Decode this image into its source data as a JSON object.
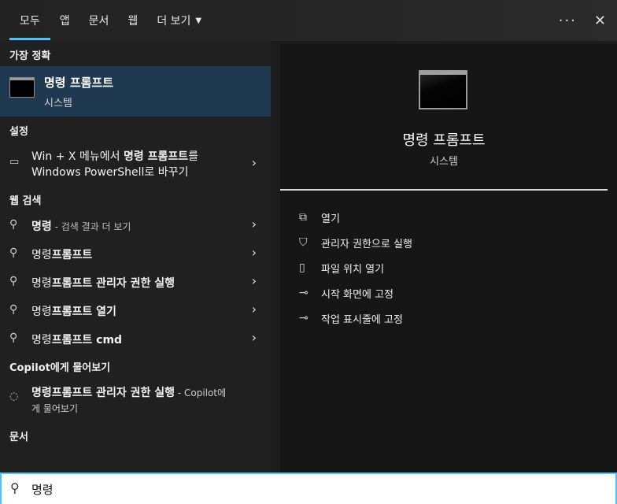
{
  "tabs": [
    {
      "label": "모두",
      "active": true
    },
    {
      "label": "앱"
    },
    {
      "label": "문서"
    },
    {
      "label": "웹"
    },
    {
      "label": "더 보기"
    }
  ],
  "top_actions": {
    "more_glyph": "···",
    "close_glyph": "✕"
  },
  "sections": {
    "best_match": "가장 정확",
    "settings": "설정",
    "web_search": "웹 검색",
    "copilot": "Copilot에게 물어보기",
    "documents": "문서"
  },
  "best_match": {
    "title": "명령 프롬프트",
    "subtitle": "시스템"
  },
  "settings_item": {
    "line1_a": "Win + X 메뉴에서 ",
    "line1_b": "명령 프롬프트",
    "line1_c": "를",
    "line2": "Windows PowerShell로 바꾸기"
  },
  "web_items": [
    {
      "bold": "명령",
      "rest": "",
      "dim": " - 검색 결과 더 보기"
    },
    {
      "bold": "명령",
      "rest": "프롬프트",
      "dim": ""
    },
    {
      "bold": "명령",
      "rest": "프롬프트 관리자 권한 실행",
      "dim": ""
    },
    {
      "bold": "명령",
      "rest": "프롬프트 열기",
      "dim": ""
    },
    {
      "bold": "명령",
      "rest": "프롬프트 cmd",
      "dim": ""
    }
  ],
  "copilot_item": {
    "main": "명령프롬프트 관리자 권한 실행",
    "dim": " - Copilot에",
    "line2": "게 물어보기"
  },
  "detail": {
    "title": "명령 프롬프트",
    "subtitle": "시스템"
  },
  "actions": [
    {
      "label": "열기",
      "icon": "open-icon"
    },
    {
      "label": "관리자 권한으로 실행",
      "icon": "shield-icon"
    },
    {
      "label": "파일 위치 열기",
      "icon": "file-location-icon"
    },
    {
      "label": "시작 화면에 고정",
      "icon": "pin-icon"
    },
    {
      "label": "작업 표시줄에 고정",
      "icon": "pin-icon"
    }
  ],
  "search": {
    "value": "명령"
  },
  "colors": {
    "accent": "#4cc2ff",
    "selected_bg": "#1f3a50"
  }
}
